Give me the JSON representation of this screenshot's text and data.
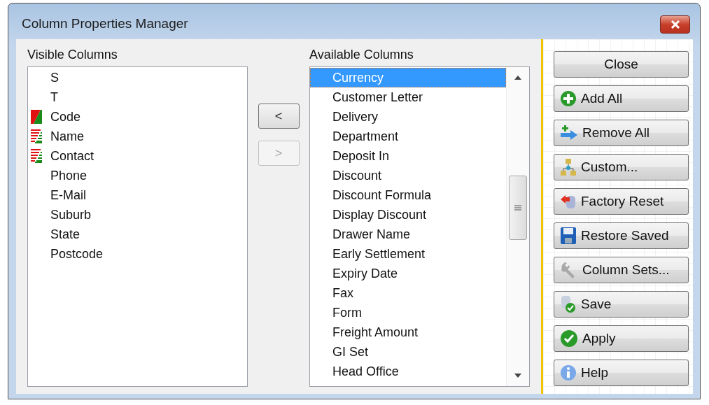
{
  "window": {
    "title": "Column Properties Manager"
  },
  "visible_columns": {
    "label": "Visible Columns",
    "items": [
      {
        "name": "S",
        "kind": "plain"
      },
      {
        "name": "T",
        "kind": "plain"
      },
      {
        "name": "Code",
        "kind": "solid"
      },
      {
        "name": "Name",
        "kind": "hatched"
      },
      {
        "name": "Contact",
        "kind": "hatched"
      },
      {
        "name": "Phone",
        "kind": "plain"
      },
      {
        "name": "E-Mail",
        "kind": "plain"
      },
      {
        "name": "Suburb",
        "kind": "plain"
      },
      {
        "name": "State",
        "kind": "plain"
      },
      {
        "name": "Postcode",
        "kind": "plain"
      }
    ]
  },
  "move_buttons": [
    {
      "label": "<",
      "disabled": false
    },
    {
      "label": ">",
      "disabled": true
    }
  ],
  "available_columns": {
    "label": "Available Columns",
    "items": [
      {
        "name": "Currency",
        "selected": true
      },
      {
        "name": "Customer Letter",
        "selected": false
      },
      {
        "name": "Delivery",
        "selected": false
      },
      {
        "name": "Department",
        "selected": false
      },
      {
        "name": "Deposit In",
        "selected": false
      },
      {
        "name": "Discount",
        "selected": false
      },
      {
        "name": "Discount Formula",
        "selected": false
      },
      {
        "name": "Display Discount",
        "selected": false
      },
      {
        "name": "Drawer Name",
        "selected": false
      },
      {
        "name": "Early Settlement",
        "selected": false
      },
      {
        "name": "Expiry Date",
        "selected": false
      },
      {
        "name": "Fax",
        "selected": false
      },
      {
        "name": "Form",
        "selected": false
      },
      {
        "name": "Freight Amount",
        "selected": false
      },
      {
        "name": "GI Set",
        "selected": false
      },
      {
        "name": "Head Office",
        "selected": false
      }
    ]
  },
  "actions": [
    {
      "label": "Close",
      "kind": "none"
    },
    {
      "label": "Add All",
      "kind": "plus"
    },
    {
      "label": "Remove All",
      "kind": "move"
    },
    {
      "label": "Custom...",
      "kind": "network"
    },
    {
      "label": "Factory Reset",
      "kind": "reset"
    },
    {
      "label": "Restore Saved",
      "kind": "floppy"
    },
    {
      "label": "Column Sets...",
      "kind": "wrench"
    },
    {
      "label": "Save",
      "kind": "save"
    },
    {
      "label": "Apply",
      "kind": "check"
    },
    {
      "label": "Help",
      "kind": "info"
    }
  ]
}
